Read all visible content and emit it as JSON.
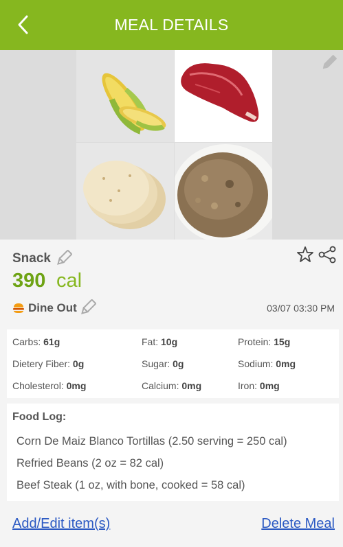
{
  "header": {
    "title": "MEAL DETAILS",
    "back_icon": "chevron-left-icon",
    "background": "#86b71f"
  },
  "photos": {
    "items": [
      "corn",
      "beef-steak",
      "tortillas",
      "refried-beans"
    ],
    "edit_icon": "pencil-icon"
  },
  "meal": {
    "type": "Snack",
    "calories": "390",
    "calories_unit": "cal",
    "location": "Dine Out",
    "datetime": "03/07 03:30 PM",
    "accent": "#6ea314"
  },
  "nutrition": {
    "carbs": {
      "label": "Carbs:",
      "value": "61g"
    },
    "fat": {
      "label": "Fat:",
      "value": "10g"
    },
    "protein": {
      "label": "Protein:",
      "value": "15g"
    },
    "fiber": {
      "label": "Dietery Fiber:",
      "value": "0g"
    },
    "sugar": {
      "label": "Sugar:",
      "value": "0g"
    },
    "sodium": {
      "label": "Sodium:",
      "value": "0mg"
    },
    "cholesterol": {
      "label": "Cholesterol:",
      "value": "0mg"
    },
    "calcium": {
      "label": "Calcium:",
      "value": "0mg"
    },
    "iron": {
      "label": "Iron:",
      "value": "0mg"
    }
  },
  "food_log": {
    "title": "Food Log:",
    "items": [
      "Corn De Maiz Blanco Tortillas (2.50 serving = 250 cal)",
      "Refried Beans (2 oz = 82 cal)",
      "Beef Steak (1 oz, with bone, cooked  = 58 cal)"
    ]
  },
  "actions": {
    "add_edit": "Add/Edit item(s)",
    "delete": "Delete Meal",
    "link_color": "#2b59c3"
  }
}
